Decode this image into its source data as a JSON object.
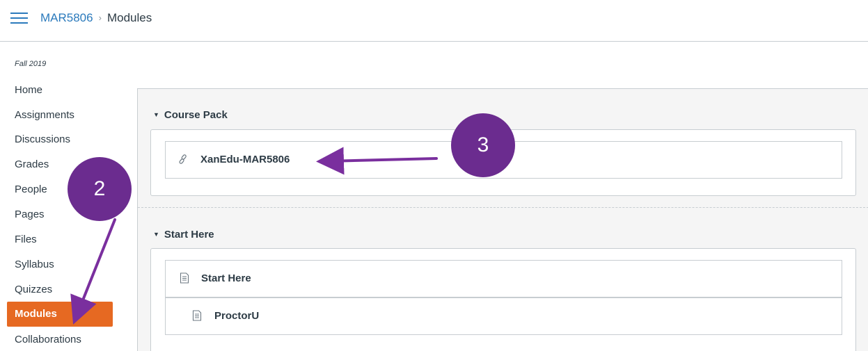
{
  "header": {
    "course": "MAR5806",
    "separator": "›",
    "current": "Modules"
  },
  "sidebar": {
    "term": "Fall 2019",
    "items": [
      {
        "label": "Home"
      },
      {
        "label": "Assignments"
      },
      {
        "label": "Discussions"
      },
      {
        "label": "Grades"
      },
      {
        "label": "People"
      },
      {
        "label": "Pages"
      },
      {
        "label": "Files"
      },
      {
        "label": "Syllabus"
      },
      {
        "label": "Quizzes"
      },
      {
        "label": "Modules",
        "active": true
      },
      {
        "label": "Collaborations"
      }
    ]
  },
  "modules": [
    {
      "title": "Course Pack",
      "items": [
        {
          "label": "XanEdu-MAR5806",
          "icon": "link-icon"
        }
      ]
    },
    {
      "title": "Start Here",
      "items": [
        {
          "label": "Start Here",
          "icon": "page-icon"
        },
        {
          "label": "ProctorU",
          "icon": "page-icon"
        }
      ]
    }
  ],
  "annotations": {
    "step2": "2",
    "step3": "3"
  },
  "colors": {
    "link": "#2b7abc",
    "active_nav": "#e66922",
    "callout": "#6b2c8f",
    "arrow": "#7a2f9e"
  }
}
